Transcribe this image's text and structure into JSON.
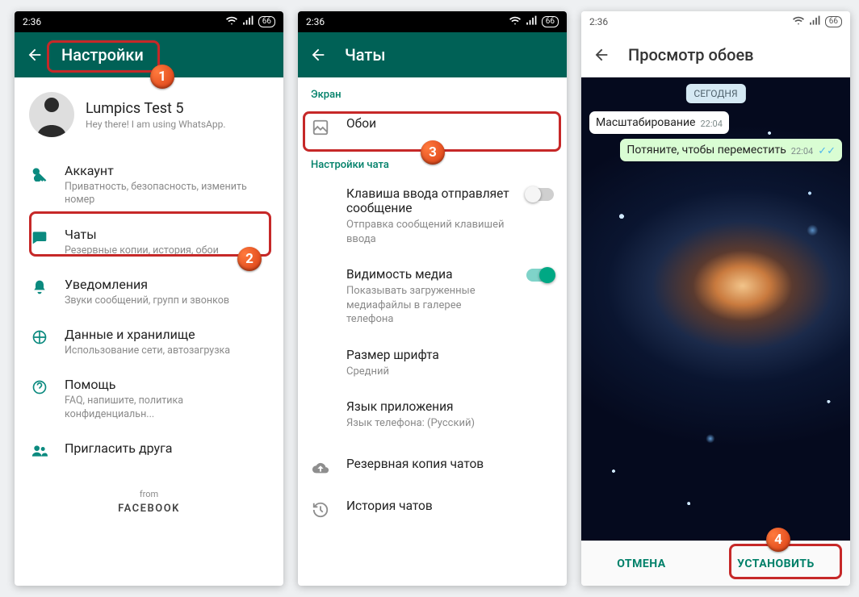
{
  "status": {
    "time": "2:36",
    "battery": "66"
  },
  "screen1": {
    "title": "Настройки",
    "profile": {
      "name": "Lumpics Test 5",
      "status": "Hey there! I am using WhatsApp."
    },
    "items": [
      {
        "title": "Аккаунт",
        "sub": "Приватность, безопасность, изменить номер"
      },
      {
        "title": "Чаты",
        "sub": "Резервные копии, история, обои"
      },
      {
        "title": "Уведомления",
        "sub": "Звуки сообщений, групп и звонков"
      },
      {
        "title": "Данные и хранилище",
        "sub": "Использование сети, автозагрузка"
      },
      {
        "title": "Помощь",
        "sub": "FAQ, напишите, политика конфиденциальн..."
      },
      {
        "title": "Пригласить друга",
        "sub": ""
      }
    ],
    "from": "from",
    "facebook": "FACEBOOK"
  },
  "screen2": {
    "title": "Чаты",
    "section_screen": "Экран",
    "wallpaper": "Обои",
    "section_chat": "Настройки чата",
    "items": {
      "enter": {
        "title": "Клавиша ввода отправляет сообщение",
        "sub": "Отправка сообщений клавишей ввода"
      },
      "media": {
        "title": "Видимость медиа",
        "sub": "Показывать загруженные медиафайлы в галерее телефона"
      },
      "font": {
        "title": "Размер шрифта",
        "sub": "Средний"
      },
      "lang": {
        "title": "Язык приложения",
        "sub": "Язык телефона: (Русский)"
      },
      "backup": "Резервная копия чатов",
      "history": "История чатов"
    }
  },
  "screen3": {
    "title": "Просмотр обоев",
    "date": "СЕГОДНЯ",
    "msg_in": {
      "text": "Масштабирование",
      "time": "22:04"
    },
    "msg_out": {
      "text": "Потяните, чтобы переместить",
      "time": "22:04"
    },
    "cancel": "ОТМЕНА",
    "set": "УСТАНОВИТЬ"
  },
  "badges": {
    "b1": "1",
    "b2": "2",
    "b3": "3",
    "b4": "4"
  }
}
